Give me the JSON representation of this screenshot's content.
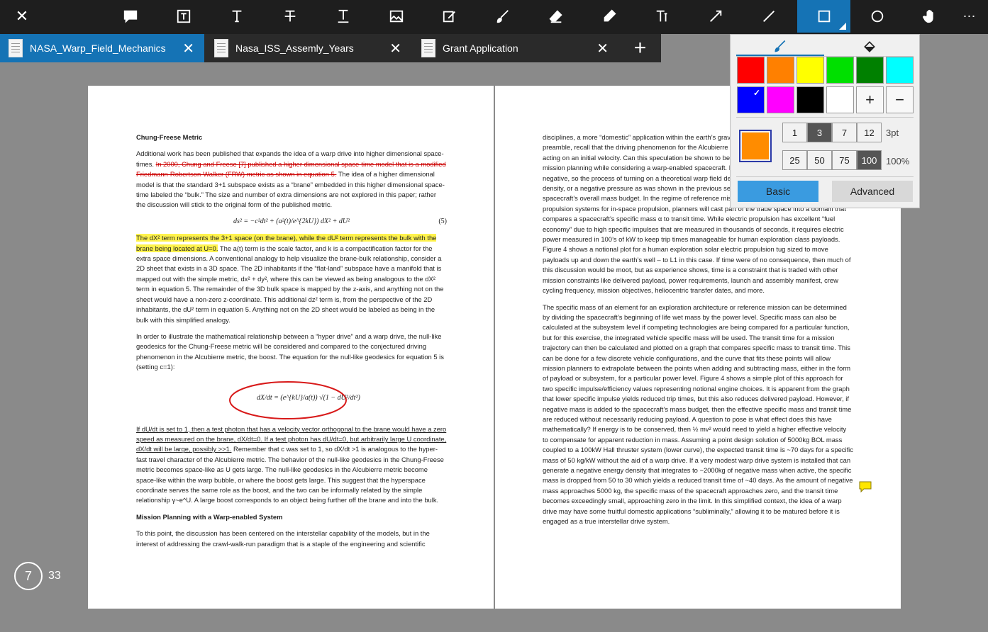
{
  "toolbar": {
    "close_label": "✕",
    "more_label": "⋯",
    "tools": [
      {
        "name": "comment-icon"
      },
      {
        "name": "text-box-icon"
      },
      {
        "name": "text-icon"
      },
      {
        "name": "strikethrough-icon"
      },
      {
        "name": "underline-text-icon"
      },
      {
        "name": "image-icon"
      },
      {
        "name": "signature-icon"
      },
      {
        "name": "brush-icon"
      },
      {
        "name": "eraser-icon"
      },
      {
        "name": "highlighter-icon"
      },
      {
        "name": "typewriter-icon"
      },
      {
        "name": "arrow-icon"
      },
      {
        "name": "line-icon"
      },
      {
        "name": "rectangle-icon",
        "active": true
      },
      {
        "name": "ellipse-icon"
      },
      {
        "name": "pan-hand-icon"
      }
    ],
    "active_color": "#1573b5"
  },
  "tabs": [
    {
      "label": "NASA_Warp_Field_Mechanics",
      "active": true
    },
    {
      "label": "Nasa_ISS_Assemly_Years",
      "active": false
    },
    {
      "label": "Grant Application",
      "active": false
    }
  ],
  "add_tab_label": "+",
  "palette": {
    "colors": [
      "#ff0000",
      "#ff8000",
      "#ffff00",
      "#00e000",
      "#008000",
      "#00ffff",
      "#0000ff",
      "#ff00ff",
      "#000000",
      "#ffffff"
    ],
    "selected_color_index": 6,
    "plus_label": "+",
    "minus_label": "−",
    "preview_color": "#ff8c00",
    "thickness": {
      "options": [
        "1",
        "3",
        "7",
        "12"
      ],
      "selected": "3",
      "label": "3pt"
    },
    "opacity": {
      "options": [
        "25",
        "50",
        "75",
        "100"
      ],
      "selected": "100",
      "label": "100%"
    },
    "basic_label": "Basic",
    "advanced_label": "Advanced"
  },
  "page_indicator": {
    "current": "7",
    "total": "33"
  },
  "left_page": {
    "heading1": "Chung-Freese Metric",
    "p1_a": "Additional work has been published that expands the idea of a warp drive into higher dimensional space-times. ",
    "p1_strike": "In 2000, Chung and Freese [7] published a higher dimensional space-time model that is a modified Friedmann-Robertson-Walker (FRW) metric as shown in equation 5.",
    "p1_b": " The idea of a higher dimensional model is that the standard 3+1 subspace exists as a “brane” embedded in this higher dimensional space-time labeled the “bulk.” The size and number of extra dimensions are not explored in this paper; rather the discussion will stick to the original form of the published metric.",
    "eq5": "ds² = −c²dt² + (a²(t)/e^{2kU}) dX² + dU²",
    "eq5_num": "(5)",
    "p2_hl": "The dX² term represents the 3+1 space (on the brane), while the dU² term represents the bulk with the brane being located at U=0.",
    "p2_b": " The a(t) term is the scale factor, and k is a compactification factor for the extra space dimensions. A conventional analogy to help visualize the brane-bulk relationship, consider a 2D sheet that exists in a 3D space. The 2D inhabitants if the “flat-land” subspace have a manifold that is mapped out with the simple metric, dx² + dy², where this can be viewed as being analogous to the dX² term in equation 5. The remainder of the 3D bulk space is mapped by the z-axis, and anything not on the sheet would have a non-zero z-coordinate. This additional dz² term is, from the perspective of the 2D inhabitants, the dU² term in equation 5. Anything not on the 2D sheet would be labeled as being in the bulk with this simplified analogy.",
    "p3": "In order to illustrate the mathematical relationship between a “hyper drive” and a warp drive, the null-like geodesics for the Chung-Freese metric will be considered and compared to the conjectured driving phenomenon in the Alcubierre metric, the boost. The equation for the null-like geodesics for equation 5 is (setting c=1):",
    "eq6": "dX/dt = (e^{kU}/a(t)) √(1 − dU²/dt²)",
    "p4_ul": "If dU/dt is set to 1, then a test photon that has a velocity vector orthogonal to the brane would have a zero speed as measured on the brane, dX/dt=0. If a test photon has dU/dt=0, but arbitrarily large U coordinate, dX/dt will be large, possibly >>1.",
    "p4_b": " Remember that c was set to 1, so dX/dt >1 is analogous to the hyper-fast travel character of the Alcubierre metric. The behavior of the null-like geodesics in the Chung-Freese metric becomes space-like as U gets large. The null-like geodesics in the Alcubierre metric become space-like within the warp bubble, or where the boost gets large. This suggest that the hyperspace coordinate serves the same role as the boost, and the two can be informally related by the simple relationship γ~e^U. A large boost corresponds to an object being further off the brane and into the bulk.",
    "heading2": "Mission Planning with a Warp-enabled System",
    "p5": "To this point, the discussion has been centered on the interstellar capability of the models, but in the interest of addressing the crawl-walk-run paradigm that is a staple of the engineering and scientific"
  },
  "right_page": {
    "p1": "disciplines, a more “domestic” application within the earth’s gravity well will be considered. As a preamble, recall that the driving phenomenon for the Alcubierre metric is a boost rather than a force acting on an initial velocity. Can this speculation be shown to be compatible with the mission or reference mission planning while considering a warp-enabled spacecraft. If the energy density of the metric is negative, so the process of turning on a theoretical warp field device would generate negative energy density, or a negative pressure as was shown in the previous section. This corresponds to the spacecraft’s overall mass budget. In the regime of reference mission planning, consider thrust electric propulsion systems for in-space propulsion, planners will cast part of the trade space into a domain that compares a spacecraft’s specific mass α to transit time. While electric propulsion has excellent “fuel economy” due to high specific impulses that are measured in thousands of seconds, it requires electric power measured in 100’s of kW to keep trip times manageable for human exploration class payloads. Figure 4 shows a notional plot for a human exploration solar electric propulsion tug sized to move payloads up and down the earth’s well – to L1 in this case. If time were of no consequence, then much of this discussion would be moot, but as experience shows, time is a constraint that is traded with other mission constraints like delivered payload, power requirements, launch and assembly manifest, crew cycling frequency, mission objectives, heliocentric transfer dates, and more.",
    "p2": "The specific mass of an element for an exploration architecture or reference mission can be determined by dividing the spacecraft’s beginning of life wet mass by the power level. Specific mass can also be calculated at the subsystem level if competing technologies are being compared for a particular function, but for this exercise, the integrated vehicle specific mass will be used. The transit time for a mission trajectory can then be calculated and plotted on a graph that compares specific mass to transit time. This can be done for a few discrete vehicle configurations, and the curve that fits these points will allow mission planners to extrapolate between the points when adding and subtracting mass, either in the form of payload or subsystem, for a particular power level. Figure 4 shows a simple plot of this approach for two specific impulse/efficiency values representing notional engine choices. It is apparent from the graph that lower specific impulse yields reduced trip times, but this also reduces delivered payload. However, if negative mass is added to the spacecraft’s mass budget, then the effective specific mass and transit time are reduced without necessarily reducing payload. A question to pose is what effect does this have mathematically? If energy is to be conserved, then ½ mv² would need to yield a higher effective velocity to compensate for apparent reduction in mass. Assuming a point design solution of 5000kg BOL mass coupled to a 100kW Hall thruster system (lower curve), the expected transit time is ~70 days for a specific mass of 50 kg/kW without the aid of a warp drive. If a very modest warp drive system is installed that can generate a negative energy density that integrates to ~2000kg of negative mass when active, the specific mass is dropped from 50 to 30 which yields a reduced transit time of ~40 days. As the amount of negative mass approaches 5000 kg, the specific mass of the spacecraft approaches zero, and the transit time becomes exceedingly small, approaching zero in the limit. In this simplified context, the idea of a warp drive may have some fruitful domestic applications “subliminally,” allowing it to be matured before it is engaged as a true interstellar drive system."
  }
}
